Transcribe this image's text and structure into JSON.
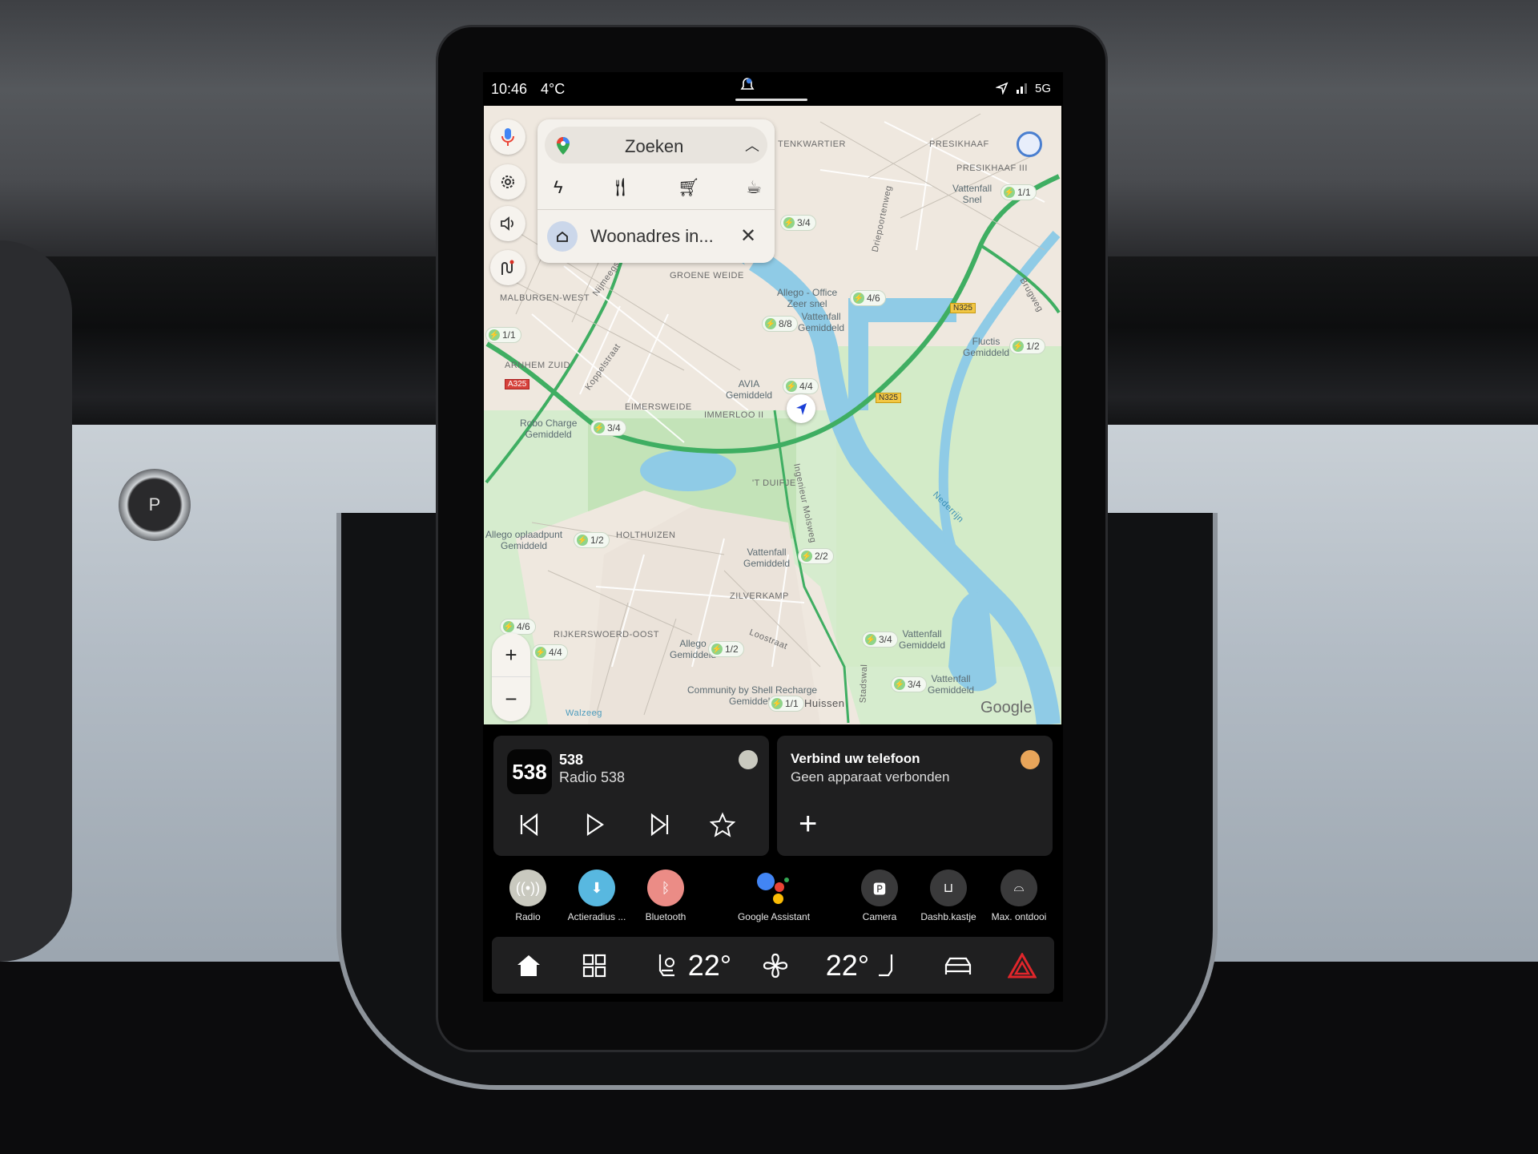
{
  "status_bar": {
    "time": "10:46",
    "temperature": "4°C",
    "network": "5G"
  },
  "map": {
    "search": {
      "label": "Zoeken",
      "categories": [
        "charging-icon",
        "restaurant-icon",
        "shopping-cart-icon",
        "coffee-icon"
      ],
      "recent": "Woonadres in..."
    },
    "areas": [
      "GROENE WEIDE",
      "MALBURGEN-WEST",
      "ARNHEM ZUID",
      "EIMERSWEIDE",
      "IMMERLOO II",
      "'T DUIFJE",
      "HOLTHUIZEN",
      "ZILVERKAMP",
      "RIJKERSWOERD-OOST",
      "PRESIKHAAF",
      "PRESIKHAAF III",
      "TENKWARTIER",
      "Huissen",
      "Walzeeg"
    ],
    "streets": [
      "Loostraat",
      "Koppelstraat",
      "Nijmeegs",
      "Driepoortenweg",
      "Ingenieur Molsweg",
      "Stadswal",
      "Brugweg",
      "Nederrijn"
    ],
    "roads": [
      "N325",
      "N325",
      "A325"
    ],
    "chargers": [
      {
        "name": "Allego - Office",
        "speed": "Zeer snel",
        "availability": "4/6"
      },
      {
        "name": "Vattenfall",
        "speed": "Gemiddeld",
        "availability": "8/8"
      },
      {
        "name": "AVIA",
        "speed": "Gemiddeld",
        "availability": "4/4"
      },
      {
        "name": "Robo Charge",
        "speed": "Gemiddeld",
        "availability": "3/4"
      },
      {
        "name": "Fluctis",
        "speed": "Gemiddeld",
        "availability": "1/2"
      },
      {
        "name": "Vattenfall",
        "speed": "Snel",
        "availability": "1/1"
      },
      {
        "name": "Vattenfall",
        "speed": "Gemiddeld",
        "availability": "2/2"
      },
      {
        "name": "Allego",
        "speed": "Gemiddeld",
        "availability": "1/2"
      },
      {
        "name": "Vattenfall",
        "speed": "Gemiddeld",
        "availability": "3/4"
      },
      {
        "name": "Vattenfall",
        "speed": "Gemiddeld",
        "availability": "3/4"
      },
      {
        "name": "Community by Shell Recharge",
        "speed": "Gemiddeld",
        "availability": "1/1"
      },
      {
        "name": "Allego oplaadpunt",
        "speed": "Gemiddeld",
        "availability": "1/2"
      },
      {
        "name": "",
        "speed": "",
        "availability": "3/4"
      },
      {
        "name": "",
        "speed": "",
        "availability": "1/1"
      },
      {
        "name": "",
        "speed": "",
        "availability": "4/6"
      },
      {
        "name": "",
        "speed": "",
        "availability": "4/4"
      }
    ],
    "attribution": "Google",
    "zoom_in": "+",
    "zoom_out": "−"
  },
  "media": {
    "logo": "538",
    "station": "538",
    "title": "Radio 538"
  },
  "phone": {
    "title": "Verbind uw telefoon",
    "subtitle": "Geen apparaat verbonden"
  },
  "apps": [
    {
      "label": "Radio",
      "color": "#c9c9bf"
    },
    {
      "label": "Actieradius ...",
      "color": "#58b8e0"
    },
    {
      "label": "Bluetooth",
      "color": "#eb8c86"
    },
    {
      "label": "Google Assistant",
      "color": ""
    },
    {
      "label": "Camera",
      "color": "#3a3a3b"
    },
    {
      "label": "Dashb.kastje",
      "color": "#3a3a3b"
    },
    {
      "label": "Max. ontdooi",
      "color": "#3a3a3b"
    }
  ],
  "climate": {
    "driver_temp": "22°",
    "passenger_temp": "22°"
  },
  "colors": {
    "map_water": "#8fcbe6",
    "map_park": "#cfe8c4",
    "highway": "#3fae62",
    "hazard": "#e0262b"
  },
  "car": {
    "gear": "P"
  }
}
